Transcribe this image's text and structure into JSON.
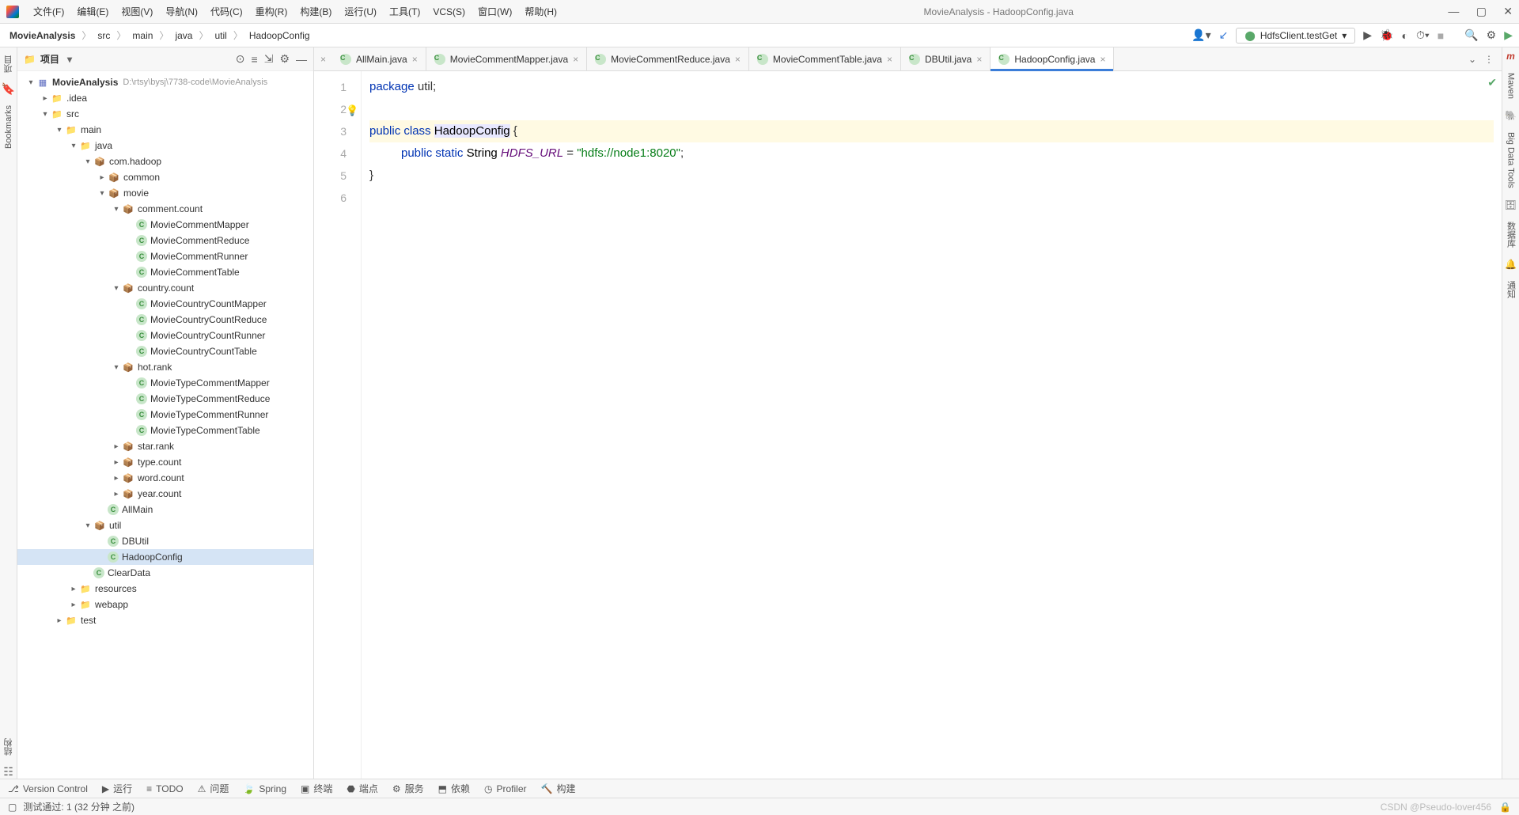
{
  "window": {
    "title": "MovieAnalysis - HadoopConfig.java"
  },
  "menu": [
    "文件(F)",
    "编辑(E)",
    "视图(V)",
    "导航(N)",
    "代码(C)",
    "重构(R)",
    "构建(B)",
    "运行(U)",
    "工具(T)",
    "VCS(S)",
    "窗口(W)",
    "帮助(H)"
  ],
  "breadcrumb": [
    "MovieAnalysis",
    "src",
    "main",
    "java",
    "util",
    "HadoopConfig"
  ],
  "run_target": "HdfsClient.testGet",
  "project_panel": {
    "title": "项目",
    "root_path": "D:\\rtsy\\bysj\\7738-code\\MovieAnalysis"
  },
  "tree": [
    {
      "d": 0,
      "exp": "▾",
      "ic": "mod",
      "t": "MovieAnalysis",
      "path": "D:\\rtsy\\bysj\\7738-code\\MovieAnalysis",
      "bold": true
    },
    {
      "d": 1,
      "exp": "▸",
      "ic": "fold",
      "t": ".idea"
    },
    {
      "d": 1,
      "exp": "▾",
      "ic": "fold",
      "t": "src"
    },
    {
      "d": 2,
      "exp": "▾",
      "ic": "fold",
      "t": "main"
    },
    {
      "d": 3,
      "exp": "▾",
      "ic": "fold",
      "t": "java"
    },
    {
      "d": 4,
      "exp": "▾",
      "ic": "pkg",
      "t": "com.hadoop"
    },
    {
      "d": 5,
      "exp": "▸",
      "ic": "pkg",
      "t": "common"
    },
    {
      "d": 5,
      "exp": "▾",
      "ic": "pkg",
      "t": "movie"
    },
    {
      "d": 6,
      "exp": "▾",
      "ic": "pkg",
      "t": "comment.count"
    },
    {
      "d": 7,
      "exp": "",
      "ic": "cls",
      "t": "MovieCommentMapper"
    },
    {
      "d": 7,
      "exp": "",
      "ic": "cls",
      "t": "MovieCommentReduce"
    },
    {
      "d": 7,
      "exp": "",
      "ic": "cls",
      "t": "MovieCommentRunner"
    },
    {
      "d": 7,
      "exp": "",
      "ic": "cls",
      "t": "MovieCommentTable"
    },
    {
      "d": 6,
      "exp": "▾",
      "ic": "pkg",
      "t": "country.count"
    },
    {
      "d": 7,
      "exp": "",
      "ic": "cls",
      "t": "MovieCountryCountMapper"
    },
    {
      "d": 7,
      "exp": "",
      "ic": "cls",
      "t": "MovieCountryCountReduce"
    },
    {
      "d": 7,
      "exp": "",
      "ic": "cls",
      "t": "MovieCountryCountRunner"
    },
    {
      "d": 7,
      "exp": "",
      "ic": "cls",
      "t": "MovieCountryCountTable"
    },
    {
      "d": 6,
      "exp": "▾",
      "ic": "pkg",
      "t": "hot.rank"
    },
    {
      "d": 7,
      "exp": "",
      "ic": "cls",
      "t": "MovieTypeCommentMapper"
    },
    {
      "d": 7,
      "exp": "",
      "ic": "cls",
      "t": "MovieTypeCommentReduce"
    },
    {
      "d": 7,
      "exp": "",
      "ic": "cls",
      "t": "MovieTypeCommentRunner"
    },
    {
      "d": 7,
      "exp": "",
      "ic": "cls",
      "t": "MovieTypeCommentTable"
    },
    {
      "d": 6,
      "exp": "▸",
      "ic": "pkg",
      "t": "star.rank"
    },
    {
      "d": 6,
      "exp": "▸",
      "ic": "pkg",
      "t": "type.count"
    },
    {
      "d": 6,
      "exp": "▸",
      "ic": "pkg",
      "t": "word.count"
    },
    {
      "d": 6,
      "exp": "▸",
      "ic": "pkg",
      "t": "year.count"
    },
    {
      "d": 5,
      "exp": "",
      "ic": "cls",
      "t": "AllMain"
    },
    {
      "d": 4,
      "exp": "▾",
      "ic": "pkg",
      "t": "util"
    },
    {
      "d": 5,
      "exp": "",
      "ic": "cls",
      "t": "DBUtil"
    },
    {
      "d": 5,
      "exp": "",
      "ic": "cls",
      "t": "HadoopConfig",
      "sel": true
    },
    {
      "d": 4,
      "exp": "",
      "ic": "cls",
      "t": "ClearData"
    },
    {
      "d": 3,
      "exp": "▸",
      "ic": "fold",
      "t": "resources"
    },
    {
      "d": 3,
      "exp": "▸",
      "ic": "fold",
      "t": "webapp"
    },
    {
      "d": 2,
      "exp": "▸",
      "ic": "fold",
      "t": "test"
    }
  ],
  "tabs": [
    {
      "t": "AllMain.java"
    },
    {
      "t": "MovieCommentMapper.java"
    },
    {
      "t": "MovieCommentReduce.java"
    },
    {
      "t": "MovieCommentTable.java"
    },
    {
      "t": "DBUtil.java"
    },
    {
      "t": "HadoopConfig.java",
      "active": true
    }
  ],
  "code": {
    "line1_pkg": "package",
    "line1_rest": " util;",
    "line3_kw1": "public",
    "line3_kw2": "class",
    "line3_cls": "HadoopConfig",
    "line3_br": " {",
    "line4_kw1": "public",
    "line4_kw2": "static",
    "line4_ty": "String",
    "line4_id": "HDFS_URL",
    "line4_eq": " = ",
    "line4_str": "\"hdfs://node1:8020\"",
    "line4_end": ";",
    "line5": "}"
  },
  "bottom_tabs": [
    "Version Control",
    "运行",
    "TODO",
    "问题",
    "Spring",
    "终端",
    "端点",
    "服务",
    "依赖",
    "Profiler",
    "构建"
  ],
  "status": {
    "text": "测试通过: 1 (32 分钟 之前)",
    "watermark": "CSDN @Pseudo-lover456"
  },
  "left_tool": {
    "project": "项目",
    "bookmarks": "Bookmarks",
    "structure": "结构"
  },
  "right_tool": {
    "maven": "Maven",
    "bigdata": "Big Data Tools",
    "db": "数据库",
    "notif": "通知"
  }
}
